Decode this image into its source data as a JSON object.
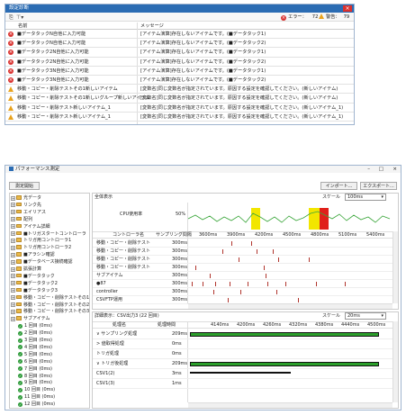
{
  "dialog1": {
    "title": "設定診断",
    "error_label": "エラー：",
    "error_count": "72",
    "warn_label": "警告：",
    "warn_count": "79",
    "col_name": "名前",
    "col_message": "メッセージ",
    "rows": [
      {
        "type": "error",
        "name": "■データタックN自他に入力可能",
        "message": "[アイテム演算]存在しないアイテムです。(■データタック1)"
      },
      {
        "type": "error",
        "name": "■データタックN自他に入力可能",
        "message": "[アイテム演算]存在しないアイテムです。(■データタック2)"
      },
      {
        "type": "error",
        "name": "■データタック2N自他に入力可能",
        "message": "[アイテム演算]存在しないアイテムです。(■データタック1)"
      },
      {
        "type": "error",
        "name": "■データタック2N自他に入力可能",
        "message": "[アイテム演算]存在しないアイテムです。(■データタック2)"
      },
      {
        "type": "error",
        "name": "■データタック3N自他に入力可能",
        "message": "[アイテム演算]存在しないアイテムです。(■データタック1)"
      },
      {
        "type": "error",
        "name": "■データタック3N自他に入力可能",
        "message": "[アイテム演算]存在しないアイテムです。(■データタック2)"
      },
      {
        "type": "warn",
        "name": "移動・コピー・削除テストその1新しいアイテム",
        "message": "[変数名]同じ変数名が指定されています。原因する設定を確認してください。(新しいアイテム)"
      },
      {
        "type": "warn",
        "name": "移動・コピー・削除テストその1新しいグループ新しいアイテム",
        "message": "[変数名]同じ変数名が指定されています。原因する設定を確認してください。(新しいアイテム)"
      },
      {
        "type": "warn",
        "name": "移動・コピー・削除テスト新しいアイテム_1",
        "message": "[変数名]同じ変数名が指定されています。原因する設定を確認してください。(新しいアイテム_1)"
      },
      {
        "type": "warn",
        "name": "移動・コピー・削除テスト新しいアイテム_1",
        "message": "[変数名]同じ変数名が指定されています。原因する設定を確認してください。(新しいアイテム_1)"
      }
    ]
  },
  "dialog2": {
    "title": "パフォーマンス測定",
    "start_button": "測定開始",
    "import_button": "インポート...",
    "export_button": "エクスポート...",
    "overall_label": "全体表示",
    "scale_label": "スケール",
    "scale_value": "100ms",
    "cpu_label": "CPU使用率",
    "cpu_percent": "50%",
    "col_controller": "コントローラ名",
    "col_sampling": "サンプリング間隔",
    "time_ticks": [
      "3600ms",
      "3900ms",
      "4200ms",
      "4500ms",
      "4800ms",
      "5100ms",
      "5400ms"
    ],
    "top_rows": [
      {
        "name": "移動・コピー・削除テスト",
        "interval": "300ms"
      },
      {
        "name": "移動・コピー・削除テスト",
        "interval": "300ms"
      },
      {
        "name": "移動・コピー・削除テスト",
        "interval": "300ms"
      },
      {
        "name": "移動・コピー・削除テスト",
        "interval": "300ms"
      },
      {
        "name": "サブアイテム",
        "interval": "300ms"
      },
      {
        "name": "●87",
        "interval": "300ms"
      },
      {
        "name": "controller",
        "interval": "300ms"
      },
      {
        "name": "CSVFTP運用",
        "interval": "300ms"
      }
    ],
    "detail_label": "詳細表示：CSV出力3 (22 回目)",
    "detail_scale_value": "20ms",
    "col_process": "処理名",
    "col_time": "処理時間",
    "detail_ticks": [
      "4140ms",
      "4200ms",
      "4260ms",
      "4320ms",
      "4380ms",
      "4440ms",
      "4500ms"
    ],
    "detail_rows": [
      {
        "name": "∨ サンプリング処理",
        "time": "209ms"
      },
      {
        "name": "> 値取得処理",
        "time": "0ms"
      },
      {
        "name": "トリガ処理",
        "time": "0ms"
      },
      {
        "name": "∨ トリガ後処理",
        "time": "209ms"
      },
      {
        "name": "CSV1(2)",
        "time": "3ms"
      },
      {
        "name": "CSV1(3)",
        "time": "1ms"
      }
    ],
    "tree_items": [
      {
        "level": 0,
        "kind": "folder",
        "label": "光データ"
      },
      {
        "level": 0,
        "kind": "folder",
        "label": "リンク先"
      },
      {
        "level": 0,
        "kind": "folder",
        "label": "エイリアス"
      },
      {
        "level": 0,
        "kind": "folder",
        "label": "配列"
      },
      {
        "level": 0,
        "kind": "folder",
        "label": "アイテム詳細"
      },
      {
        "level": 0,
        "kind": "folder",
        "label": "■トリガスタートコントローラ"
      },
      {
        "level": 0,
        "kind": "folder",
        "label": "トリガ用コントローラ1"
      },
      {
        "level": 0,
        "kind": "folder",
        "label": "トリガ用コントローラ2"
      },
      {
        "level": 0,
        "kind": "folder",
        "label": "■アラシン確認"
      },
      {
        "level": 0,
        "kind": "folder",
        "label": "■データベース接続確認"
      },
      {
        "level": 0,
        "kind": "folder",
        "label": "拡張計算"
      },
      {
        "level": 0,
        "kind": "folder",
        "label": "■データタック"
      },
      {
        "level": 0,
        "kind": "folder",
        "label": "■データタック2"
      },
      {
        "level": 0,
        "kind": "folder",
        "label": "■データタック3"
      },
      {
        "level": 0,
        "kind": "folder",
        "label": "移動・コピー・削除テストその1"
      },
      {
        "level": 0,
        "kind": "folder",
        "label": "移動・コピー・削除テストその2"
      },
      {
        "level": 0,
        "kind": "folder",
        "label": "移動・コピー・削除テストその3"
      },
      {
        "level": 0,
        "kind": "folder",
        "label": "サブアイテム"
      },
      {
        "level": 1,
        "kind": "check",
        "label": "1 回目 (0ms)"
      },
      {
        "level": 1,
        "kind": "check",
        "label": "2 回目 (0ms)"
      },
      {
        "level": 1,
        "kind": "check",
        "label": "3 回目 (0ms)"
      },
      {
        "level": 1,
        "kind": "check",
        "label": "4 回目 (0ms)"
      },
      {
        "level": 1,
        "kind": "check",
        "label": "5 回目 (0ms)"
      },
      {
        "level": 1,
        "kind": "check",
        "label": "6 回目 (0ms)"
      },
      {
        "level": 1,
        "kind": "check",
        "label": "7 回目 (0ms)"
      },
      {
        "level": 1,
        "kind": "check",
        "label": "8 回目 (0ms)"
      },
      {
        "level": 1,
        "kind": "check",
        "label": "9 回目 (0ms)"
      },
      {
        "level": 1,
        "kind": "check",
        "label": "10 回目 (0ms)"
      },
      {
        "level": 1,
        "kind": "check",
        "label": "11 回目 (0ms)"
      },
      {
        "level": 1,
        "kind": "check",
        "label": "12 回目 (0ms)"
      }
    ]
  },
  "colors": {
    "titlebar": "#2b6cb3",
    "error": "#d9322f",
    "warning": "#e8a21d",
    "cpu_line": "#3aa63a",
    "cpu_highlight_yellow": "#f2e600",
    "cpu_highlight_red": "#e0201a",
    "bar": "#2a9e2a",
    "tick_mark": "#b0342c"
  },
  "icons": {
    "error": "error-icon",
    "warning": "warning-icon",
    "folder": "folder-icon",
    "check": "check-icon",
    "close": "close-icon"
  }
}
